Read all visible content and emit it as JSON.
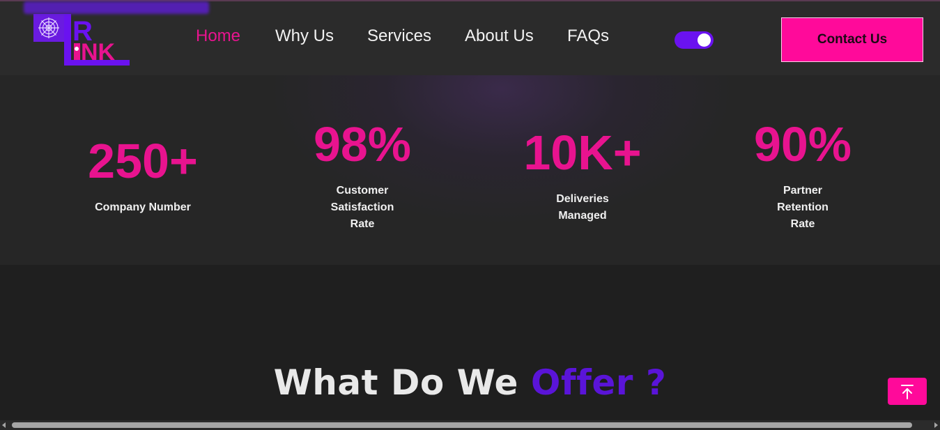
{
  "header": {
    "logo_alt": "LINK logo",
    "nav": [
      {
        "label": "Home",
        "active": true
      },
      {
        "label": "Why Us",
        "active": false
      },
      {
        "label": "Services",
        "active": false
      },
      {
        "label": "About Us",
        "active": false
      },
      {
        "label": "FAQs",
        "active": false
      }
    ],
    "theme_toggle_on": true,
    "contact_label": "Contact Us"
  },
  "stats": [
    {
      "value": "250+",
      "label": [
        "Company Number"
      ]
    },
    {
      "value": "98%",
      "label": [
        "Customer",
        "Satisfaction",
        "Rate"
      ]
    },
    {
      "value": "10K+",
      "label": [
        "Deliveries",
        "Managed"
      ]
    },
    {
      "value": "90%",
      "label": [
        "Partner",
        "Retention",
        "Rate"
      ]
    }
  ],
  "offer": {
    "heading_main": "What Do We ",
    "heading_accent": "Offer ?"
  },
  "icons": {
    "scroll_top": "arrow-up-to-line-icon",
    "logo_web": "spider-web-icon"
  },
  "colors": {
    "accent_pink": "#e8138f",
    "button_pink": "#ff0a9a",
    "accent_purple": "#6a12f0",
    "background": "#1f1f1f",
    "navbar": "#2b2b2b"
  }
}
